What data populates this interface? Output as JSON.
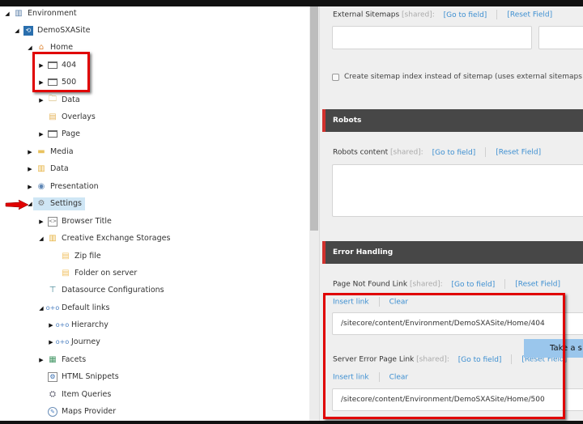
{
  "tree": {
    "nodes": [
      {
        "label": "Environment",
        "icon": "building-icon",
        "toggle": "expanded"
      },
      {
        "label": "DemoSXASite",
        "icon": "site-icon",
        "toggle": "expanded"
      },
      {
        "label": "Home",
        "icon": "home-icon",
        "toggle": "expanded"
      },
      {
        "label": "404",
        "icon": "page-icon",
        "toggle": "collapsed"
      },
      {
        "label": "500",
        "icon": "page-icon",
        "toggle": "collapsed"
      },
      {
        "label": "Data",
        "icon": "data-folder-icon",
        "toggle": "collapsed"
      },
      {
        "label": "Overlays",
        "icon": "overlays-folder-icon",
        "toggle": "none"
      },
      {
        "label": "Page",
        "icon": "page-icon",
        "toggle": "collapsed"
      },
      {
        "label": "Media",
        "icon": "media-folder-icon",
        "toggle": "collapsed"
      },
      {
        "label": "Data",
        "icon": "data-stack-icon",
        "toggle": "collapsed"
      },
      {
        "label": "Presentation",
        "icon": "eye-icon",
        "toggle": "collapsed"
      },
      {
        "label": "Settings",
        "icon": "gears-icon",
        "toggle": "expanded",
        "selected": true
      },
      {
        "label": "Browser Title",
        "icon": "code-doc-icon",
        "toggle": "collapsed"
      },
      {
        "label": "Creative Exchange Storages",
        "icon": "storage-icon",
        "toggle": "expanded"
      },
      {
        "label": "Zip file",
        "icon": "storage-item-icon",
        "toggle": "none"
      },
      {
        "label": "Folder on server",
        "icon": "storage-item-icon",
        "toggle": "none"
      },
      {
        "label": "Datasource Configurations",
        "icon": "signpost-icon",
        "toggle": "none"
      },
      {
        "label": "Default links",
        "icon": "link-icon",
        "toggle": "expanded"
      },
      {
        "label": "Hierarchy",
        "icon": "link-icon",
        "toggle": "collapsed"
      },
      {
        "label": "Journey",
        "icon": "link-icon",
        "toggle": "collapsed"
      },
      {
        "label": "Facets",
        "icon": "facets-icon",
        "toggle": "collapsed"
      },
      {
        "label": "HTML Snippets",
        "icon": "gear-doc-icon",
        "toggle": "none"
      },
      {
        "label": "Item Queries",
        "icon": "query-icon",
        "toggle": "none"
      },
      {
        "label": "Maps Provider",
        "icon": "map-icon",
        "toggle": "none"
      }
    ]
  },
  "editor": {
    "external_sitemaps": {
      "label": "External Sitemaps",
      "shared": "[shared]:",
      "goto": "[Go to field]",
      "reset": "[Reset Field]",
      "value1": "",
      "value2": ""
    },
    "sitemap_index_checkbox": {
      "label": "Create sitemap index instead of sitemap (uses external sitemaps",
      "checked": false
    },
    "robots_section": "Robots",
    "robots_content": {
      "label": "Robots content",
      "shared": "[shared]:",
      "goto": "[Go to field]",
      "reset": "[Reset Field]",
      "value": ""
    },
    "error_section": "Error Handling",
    "page_not_found": {
      "label": "Page Not Found Link",
      "shared": "[shared]:",
      "goto": "[Go to field]",
      "reset": "[Reset Field]",
      "insert": "Insert link",
      "clear": "Clear",
      "value": "/sitecore/content/Environment/DemoSXASite/Home/404"
    },
    "server_error": {
      "label": "Server Error Page Link",
      "shared": "[shared]:",
      "goto": "[Go to field]",
      "reset": "[Reset Field]",
      "insert": "Insert link",
      "clear": "Clear",
      "value": "/sitecore/content/Environment/DemoSXASite/Home/500"
    }
  },
  "tooltip": "Take a s",
  "colors": {
    "accent_red": "#d0312d",
    "link_blue": "#3d8fd1",
    "section_bg": "#474747",
    "highlight_red": "#e00000",
    "selection": "#cfe6f5"
  }
}
